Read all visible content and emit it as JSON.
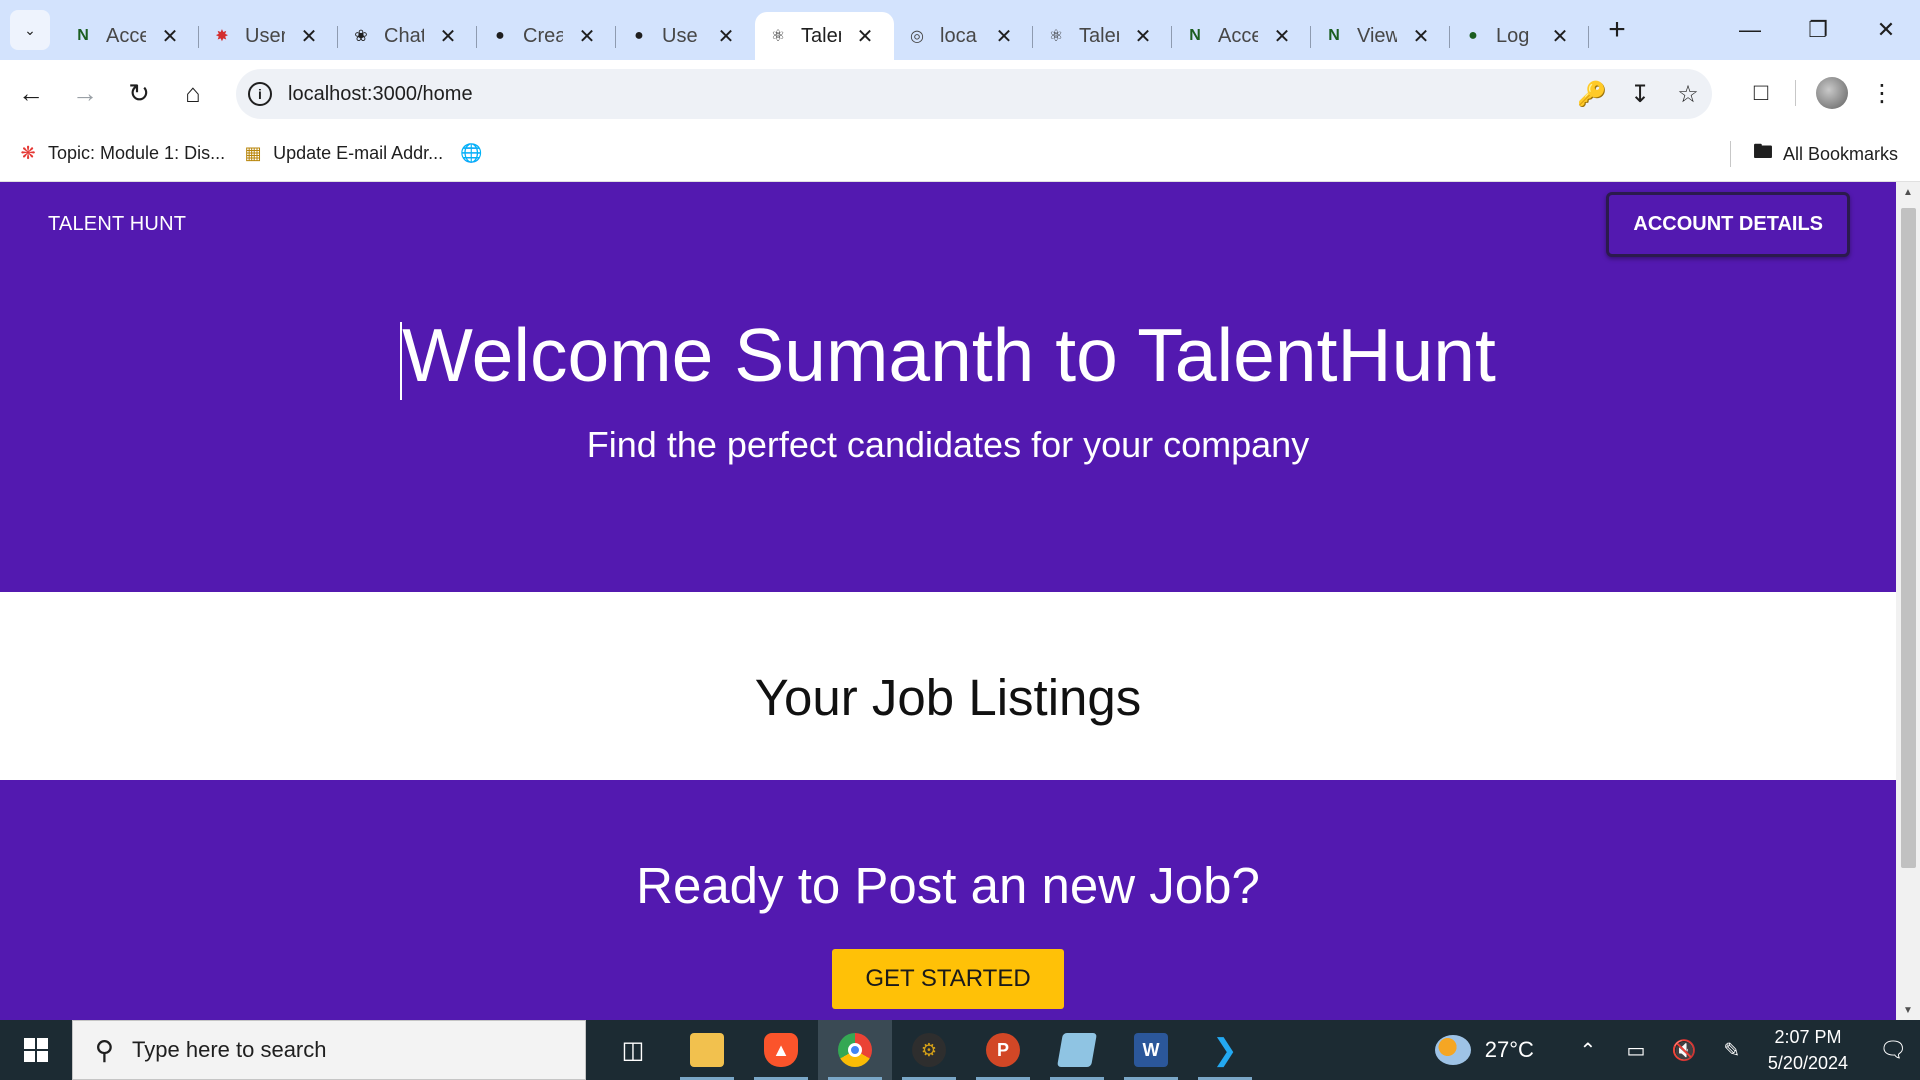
{
  "browser": {
    "tabs": [
      {
        "title": "Acce",
        "icon": "notion-n",
        "color": "#1b5e20",
        "active": false
      },
      {
        "title": "User",
        "icon": "react-red",
        "color": "#d32f2f",
        "active": false
      },
      {
        "title": "Chat",
        "icon": "openai",
        "color": "#1f1f1f",
        "active": false
      },
      {
        "title": "Crea",
        "icon": "github",
        "color": "#1f1f1f",
        "active": false
      },
      {
        "title": "Use",
        "icon": "github",
        "color": "#1f1f1f",
        "active": false
      },
      {
        "title": "Talen",
        "icon": "react",
        "color": "#1f1f1f",
        "active": true
      },
      {
        "title": "loca",
        "icon": "globe",
        "color": "#474747",
        "active": false
      },
      {
        "title": "Talen",
        "icon": "react",
        "color": "#1f1f1f",
        "active": false
      },
      {
        "title": "Acce",
        "icon": "notion-n",
        "color": "#1b5e20",
        "active": false
      },
      {
        "title": "View",
        "icon": "notion-n",
        "color": "#1b5e20",
        "active": false
      },
      {
        "title": "Log",
        "icon": "mongodb-leaf",
        "color": "#1b5e20",
        "active": false
      }
    ],
    "url": "localhost:3000/home",
    "bookmarks": [
      {
        "label": "Topic: Module 1: Dis...",
        "icon": "canvas-icon"
      },
      {
        "label": "Update E-mail Addr...",
        "icon": "chart-image-icon"
      },
      {
        "label": "",
        "icon": "globe-icon"
      }
    ],
    "all_bookmarks_label": "All Bookmarks"
  },
  "page": {
    "brand": "TALENT HUNT",
    "account_button": "ACCOUNT DETAILS",
    "hero_title": "Welcome Sumanth to TalentHunt",
    "hero_subtitle": "Find the perfect candidates for your company",
    "listings_title": "Your Job Listings",
    "cta_title": "Ready to Post an new Job?",
    "cta_button": "GET STARTED",
    "colors": {
      "primary": "#5319b0",
      "accent": "#ffc107"
    }
  },
  "taskbar": {
    "search_placeholder": "Type here to search",
    "apps": [
      {
        "name": "task-view",
        "label": ""
      },
      {
        "name": "file-explorer",
        "label": ""
      },
      {
        "name": "brave",
        "label": ""
      },
      {
        "name": "chrome",
        "label": ""
      },
      {
        "name": "settings-app",
        "label": ""
      },
      {
        "name": "powerpoint",
        "label": "P"
      },
      {
        "name": "notepad",
        "label": ""
      },
      {
        "name": "word",
        "label": "W"
      },
      {
        "name": "vscode",
        "label": ""
      }
    ],
    "temperature": "27°C",
    "time": "2:07 PM",
    "date": "5/20/2024"
  }
}
